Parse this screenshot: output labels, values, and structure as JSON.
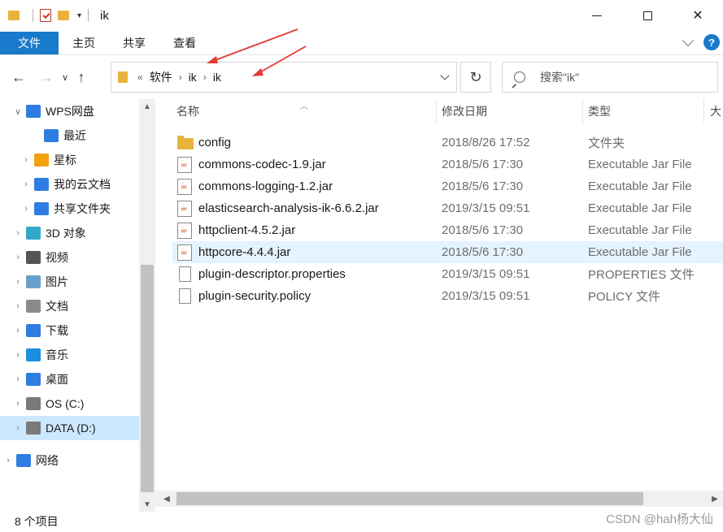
{
  "window": {
    "title": "ik",
    "minimize_glyph": "—",
    "close_glyph": "✕"
  },
  "ribbon": {
    "tabs": [
      "文件",
      "主页",
      "共享",
      "查看"
    ],
    "help_glyph": "?"
  },
  "nav": {
    "back_glyph": "←",
    "forward_glyph": "→",
    "recent_glyph": "∨",
    "up_glyph": "↑",
    "refresh_glyph": "↻",
    "breadcrumb_overflow": "«",
    "breadcrumb": [
      "软件",
      "ik",
      "ik"
    ],
    "crumb_sep": "›",
    "search_placeholder": "搜索\"ik\""
  },
  "sidebar": {
    "items": [
      {
        "label": "WPS网盘",
        "icon": "cloud-icon",
        "color": "#2f7de1",
        "expander": "∨",
        "selected": false
      },
      {
        "label": "最近",
        "icon": "clock-icon",
        "color": "#2f7de1",
        "expander": "",
        "selected": false
      },
      {
        "label": "星标",
        "icon": "star-icon",
        "color": "#f2a20c",
        "expander": "›",
        "selected": false
      },
      {
        "label": "我的云文档",
        "icon": "cloud-icon",
        "color": "#2f7de1",
        "expander": "›",
        "selected": false
      },
      {
        "label": "共享文件夹",
        "icon": "share-icon",
        "color": "#2f7de1",
        "expander": "›",
        "selected": false
      },
      {
        "label": "3D 对象",
        "icon": "cube-icon",
        "color": "#35a7c9",
        "expander": "›",
        "selected": false
      },
      {
        "label": "视频",
        "icon": "film-icon",
        "color": "#555555",
        "expander": "›",
        "selected": false
      },
      {
        "label": "图片",
        "icon": "picture-icon",
        "color": "#6aa0c9",
        "expander": "›",
        "selected": false
      },
      {
        "label": "文档",
        "icon": "document-icon",
        "color": "#8b8b8b",
        "expander": "›",
        "selected": false
      },
      {
        "label": "下载",
        "icon": "download-icon",
        "color": "#2f7de1",
        "expander": "›",
        "selected": false
      },
      {
        "label": "音乐",
        "icon": "music-icon",
        "color": "#1a8fe0",
        "expander": "›",
        "selected": false
      },
      {
        "label": "桌面",
        "icon": "desktop-icon",
        "color": "#2f7de1",
        "expander": "›",
        "selected": false
      },
      {
        "label": "OS (C:)",
        "icon": "drive-icon",
        "color": "#7a7a7a",
        "expander": "›",
        "selected": false
      },
      {
        "label": "DATA (D:)",
        "icon": "drive-icon",
        "color": "#7a7a7a",
        "expander": "›",
        "selected": true
      },
      {
        "label": "网络",
        "icon": "network-icon",
        "color": "#2f7de1",
        "expander": "›",
        "selected": false
      }
    ]
  },
  "columns": {
    "name": "名称",
    "modified": "修改日期",
    "type": "类型",
    "size": "大"
  },
  "files": [
    {
      "name": "config",
      "date": "2018/8/26 17:52",
      "type": "文件夹",
      "icon": "folder-icon",
      "selected": false
    },
    {
      "name": "commons-codec-1.9.jar",
      "date": "2018/5/6 17:30",
      "type": "Executable Jar File",
      "icon": "jar-icon",
      "selected": false
    },
    {
      "name": "commons-logging-1.2.jar",
      "date": "2018/5/6 17:30",
      "type": "Executable Jar File",
      "icon": "jar-icon",
      "selected": false
    },
    {
      "name": "elasticsearch-analysis-ik-6.6.2.jar",
      "date": "2019/3/15 09:51",
      "type": "Executable Jar File",
      "icon": "jar-icon",
      "selected": false
    },
    {
      "name": "httpclient-4.5.2.jar",
      "date": "2018/5/6 17:30",
      "type": "Executable Jar File",
      "icon": "jar-icon",
      "selected": false
    },
    {
      "name": "httpcore-4.4.4.jar",
      "date": "2018/5/6 17:30",
      "type": "Executable Jar File",
      "icon": "jar-icon",
      "selected": true
    },
    {
      "name": "plugin-descriptor.properties",
      "date": "2019/3/15 09:51",
      "type": "PROPERTIES 文件",
      "icon": "file-icon",
      "selected": false
    },
    {
      "name": "plugin-security.policy",
      "date": "2019/3/15 09:51",
      "type": "POLICY 文件",
      "icon": "file-icon",
      "selected": false
    }
  ],
  "status": {
    "count": "8 个项目"
  },
  "watermark": "CSDN @hah杨大仙",
  "colors": {
    "accent": "#1979ca",
    "selection": "#cce8ff",
    "annotation_arrow": "#e53935"
  }
}
